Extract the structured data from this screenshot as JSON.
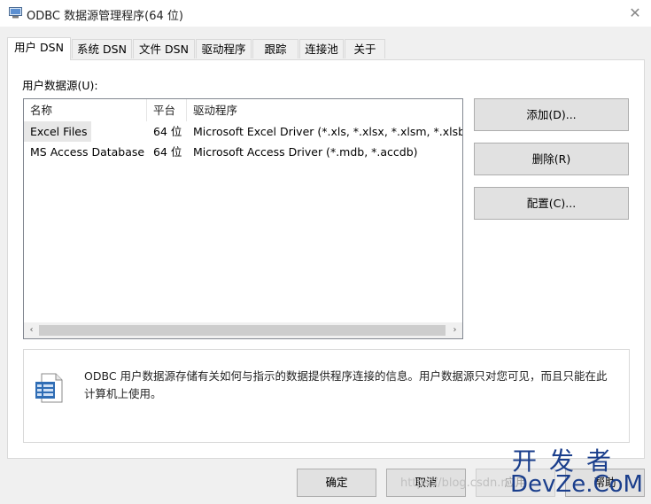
{
  "window": {
    "title": "ODBC 数据源管理程序(64 位)",
    "close_glyph": "✕"
  },
  "tabs": [
    {
      "label": "用户 DSN",
      "active": true
    },
    {
      "label": "系统 DSN"
    },
    {
      "label": "文件 DSN"
    },
    {
      "label": "驱动程序"
    },
    {
      "label": "跟踪"
    },
    {
      "label": "连接池"
    },
    {
      "label": "关于"
    }
  ],
  "user_dsn": {
    "section_label": "用户数据源(U):",
    "columns": [
      "名称",
      "平台",
      "驱动程序"
    ],
    "rows": [
      {
        "name": "Excel Files",
        "platform": "64 位",
        "driver": "Microsoft Excel Driver (*.xls, *.xlsx, *.xlsm, *.xlsb)",
        "selected": true
      },
      {
        "name": "MS Access Database",
        "platform": "64 位",
        "driver": "Microsoft Access Driver (*.mdb, *.accdb)"
      }
    ],
    "scroll_left": "‹",
    "scroll_right": "›",
    "buttons": {
      "add": "添加(D)...",
      "remove": "删除(R)",
      "configure": "配置(C)..."
    },
    "info_text": "ODBC 用户数据源存储有关如何与指示的数据提供程序连接的信息。用户数据源只对您可见，而且只能在此计算机上使用。",
    "info_icon": "document-database-icon"
  },
  "footer": {
    "ok": "确定",
    "cancel": "取消",
    "apply": "应用",
    "help": "帮助"
  },
  "watermark": {
    "url": "https://blog.csdn.n",
    "logo_top": "开发者",
    "logo_bottom": "DevZe.CoM"
  },
  "colors": {
    "accent": "#0078d7",
    "watermark": "#1a3e8c"
  }
}
